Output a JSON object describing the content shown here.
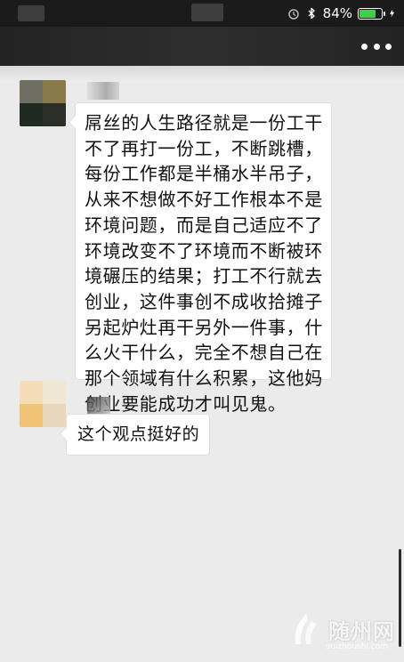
{
  "status_bar": {
    "battery_percent_label": "84%",
    "battery_level": 0.84,
    "icons": [
      "alarm-icon",
      "bluetooth-icon",
      "battery-icon",
      "charging-icon"
    ]
  },
  "nav": {
    "more_icon": "more-dots-icon"
  },
  "messages": [
    {
      "text": "屌丝的人生路径就是一份工干不了再打一份工，不断跳槽，每份工作都是半桶水半吊子，从来不想做不好工作根本不是环境问题，而是自己适应不了环境改变不了环境而不断被环境碾压的结果；打工不行就去创业，这件事创不成收拾摊子另起炉灶再干另外一件事，什么火干什么，完全不想自己在那个领域有什么积累，这他妈创业要能成功才叫见鬼。"
    },
    {
      "text": "这个观点挺好的"
    }
  ],
  "watermark": {
    "text": "随州网",
    "sub": "suizhoushi.com"
  },
  "colors": {
    "background": "#ebebeb",
    "status_bar": "#1b1b1b",
    "bubble": "#ffffff",
    "battery_fill": "#3ad14a"
  }
}
